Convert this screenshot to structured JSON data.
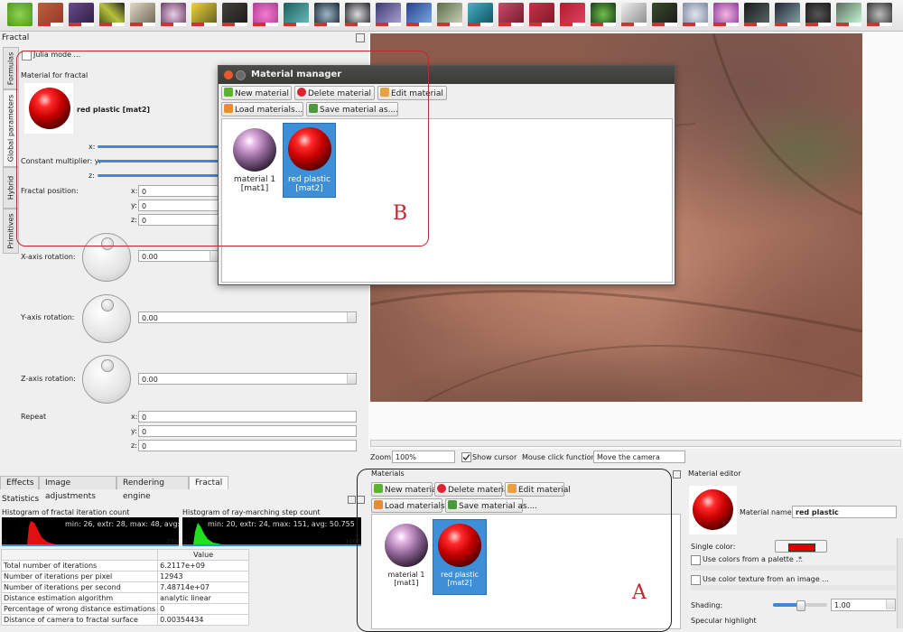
{
  "window": {
    "fractal_panel_title": "Fractal"
  },
  "fractal_panel": {
    "julia_mode_label": "Julia mode ...",
    "material_for_fractal_label": "Material for fractal",
    "material_name": "red plastic [mat2]",
    "x_label": "x:",
    "constant_multiplier_label": "Constant multiplier: y:",
    "z_label": "z:",
    "fractal_position_label": "Fractal position:",
    "pos_x_label": "x:",
    "pos_x_value": "0",
    "pos_y_label": "y:",
    "pos_y_value": "0",
    "pos_z_label": "z:",
    "pos_z_value": "0",
    "x_axis_rotation_label": "X-axis rotation:",
    "x_axis_rotation_value": "0.00",
    "y_axis_rotation_label": "Y-axis rotation:",
    "y_axis_rotation_value": "0.00",
    "z_axis_rotation_label": "Z-axis rotation:",
    "z_axis_rotation_value": "0.00",
    "repeat_label": "Repeat",
    "repeat_x_label": "x:",
    "repeat_x_value": "0",
    "repeat_y_label": "y:",
    "repeat_y_value": "0",
    "repeat_z_label": "z:",
    "repeat_z_value": "0",
    "vertical_tabs": [
      "Formulas",
      "Global parameters",
      "Hybrid",
      "Primitives"
    ]
  },
  "bottom_tabs": [
    "Effects",
    "Image adjustments",
    "Rendering engine",
    "Fractal"
  ],
  "statistics": {
    "title": "Statistics",
    "histogram1_title": "Histogram of fractal iteration count",
    "histogram1_text": "min: 26, extr: 28, max: 48, avg: 34.0791",
    "histogram1_axis_start": "0",
    "histogram1_axis_end": "250",
    "histogram2_title": "Histogram of ray-marching step count",
    "histogram2_text": "min: 20, extr: 24, max: 151, avg: 50.755",
    "histogram2_axis_start": "0",
    "histogram2_axis_end": "1000",
    "value_header": "Value",
    "rows": [
      {
        "label": "Total number of iterations",
        "value": "6.2117e+09"
      },
      {
        "label": "Number of iterations per pixel",
        "value": "12943"
      },
      {
        "label": "Number of iterations per second",
        "value": "7.48714e+07"
      },
      {
        "label": "Distance estimation algorithm",
        "value": "analytic linear"
      },
      {
        "label": "Percentage of wrong distance estimations",
        "value": "0"
      },
      {
        "label": "Distance of camera to fractal surface",
        "value": "0.00354434"
      }
    ]
  },
  "render_bar": {
    "zoom_label": "Zoom:",
    "zoom_value": "100%",
    "show_cursor_label": "Show cursor",
    "mouse_click_label": "Mouse click function:",
    "mouse_click_value": "Move the camera"
  },
  "materials_dock": {
    "title": "Materials",
    "new_material": "New material",
    "delete_material": "Delete material",
    "edit_material": "Edit material",
    "load_materials": "Load materials...",
    "save_material_as": "Save material as....",
    "items": [
      {
        "name": "material 1",
        "id": "[mat1]"
      },
      {
        "name": "red plastic",
        "id": "[mat2]"
      }
    ],
    "annotation": "A"
  },
  "material_manager": {
    "title": "Material manager",
    "new_material": "New material",
    "delete_material": "Delete material",
    "edit_material": "Edit material",
    "load_materials": "Load materials...",
    "save_material_as": "Save material as....",
    "items": [
      {
        "name": "material 1",
        "id": "[mat1]"
      },
      {
        "name": "red plastic",
        "id": "[mat2]"
      }
    ],
    "annotation": "B"
  },
  "material_editor": {
    "title": "Material editor",
    "material_name_label": "Material name:",
    "material_name_value": "red plastic",
    "single_color_label": "Single color:",
    "single_color_hex": "#e00000",
    "use_palette_label": "Use colors from a palette ...",
    "palette_asterisk": "*",
    "use_texture_label": "Use color texture from an image ...",
    "shading_label": "Shading:",
    "shading_value": "1.00",
    "shading_fraction": 0.5,
    "specular_label": "Specular highlight"
  },
  "colors": {
    "selection": "#3d8fd8",
    "annotation": "#c0282e",
    "accent": "#3b8ad2"
  }
}
